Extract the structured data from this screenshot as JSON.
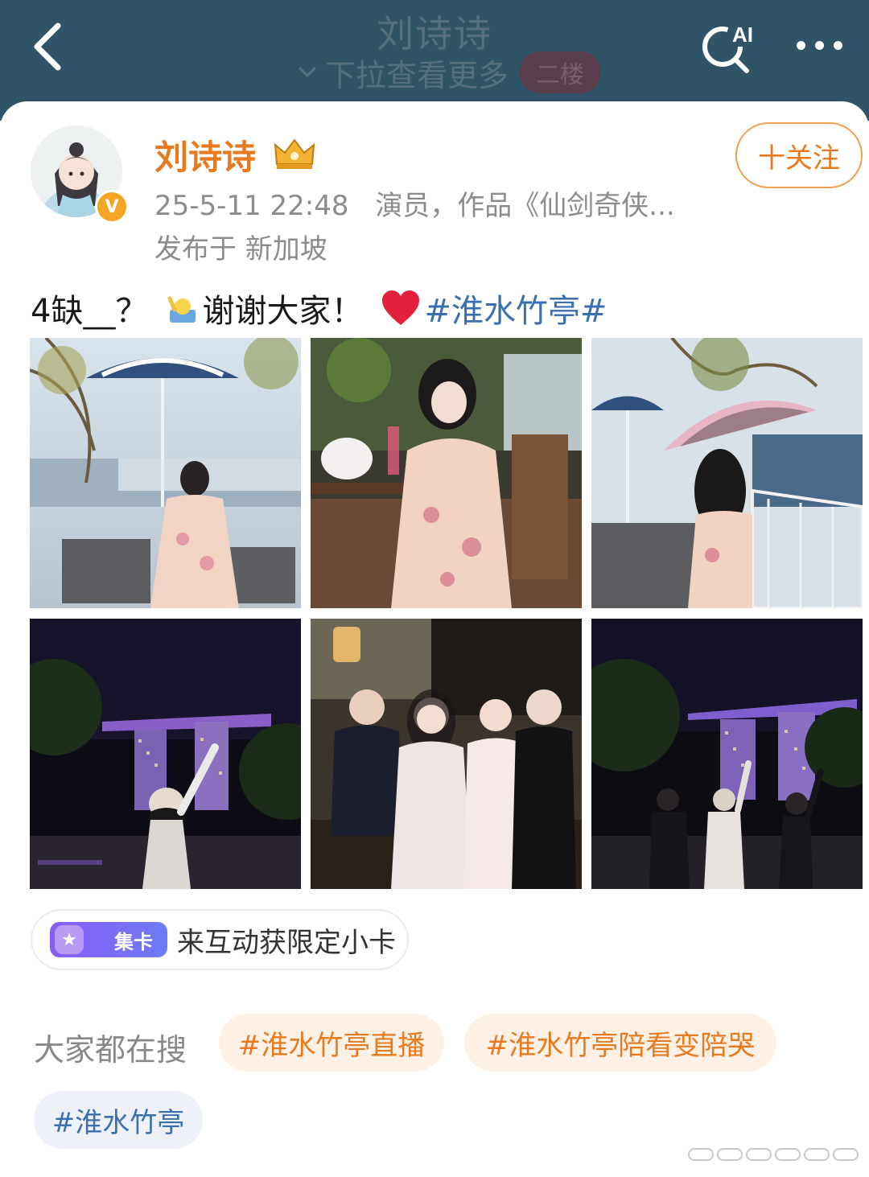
{
  "topbar": {
    "title": "刘诗诗",
    "pull_hint": "下拉查看更多",
    "floor_badge": "二楼",
    "icons": [
      "back-icon",
      "ai-search-icon",
      "more-icon"
    ]
  },
  "post": {
    "author": "刘诗诗",
    "timestamp": "25-5-11 22:48",
    "bio": "演员，作品《仙剑奇侠...",
    "location": "发布于 新加坡",
    "follow_label": "十关注",
    "text_before": "4缺__？",
    "text_middle": "谢谢大家！",
    "hashtag": "#淮水竹亭#",
    "photos": [
      {
        "name": "rooftop-umbrella-photo"
      },
      {
        "name": "cafe-table-photo"
      },
      {
        "name": "parasol-balcony-photo"
      },
      {
        "name": "night-skyline-wave-photo"
      },
      {
        "name": "group-selfie-photo"
      },
      {
        "name": "night-group-wave-photo"
      }
    ]
  },
  "promo": {
    "badge": "集卡",
    "text": "来互动获限定小卡"
  },
  "trending": {
    "label": "大家都在搜",
    "chips": [
      "#淮水竹亭直播",
      "#淮水竹亭陪看变陪哭",
      "#淮水竹亭"
    ]
  },
  "colors": {
    "topbar": "#2f5468",
    "accent_orange": "#e77a1f",
    "link_blue": "#3a6fb0"
  }
}
